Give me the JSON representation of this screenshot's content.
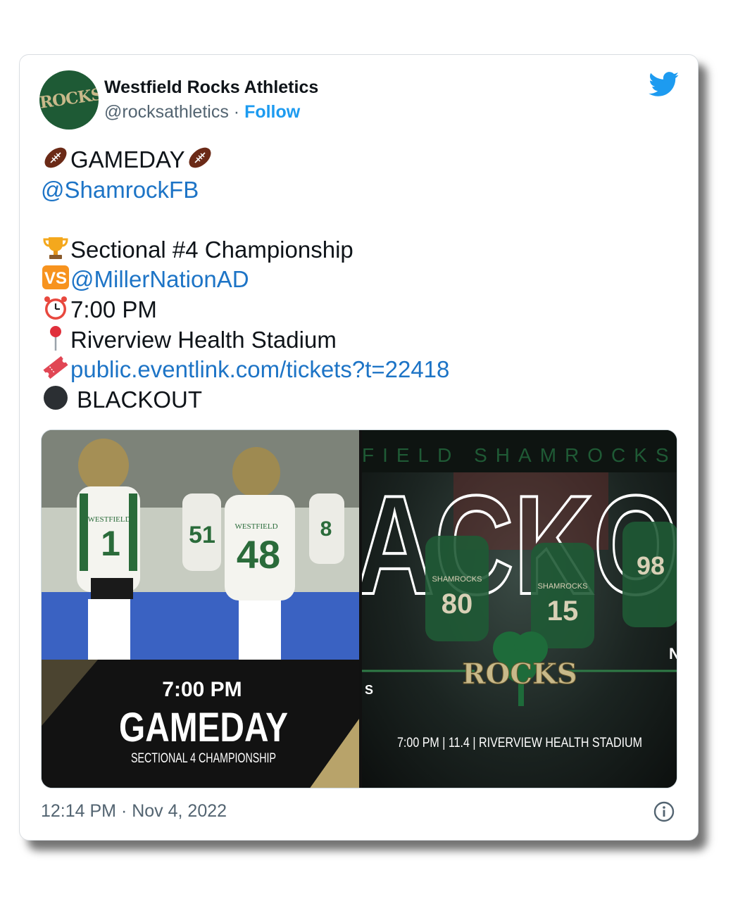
{
  "account": {
    "display_name": "Westfield Rocks Athletics",
    "handle": "@rocksathletics",
    "separator": "·",
    "follow_label": "Follow",
    "avatar_text": "ROCKS",
    "avatar_color": "#1e5a35"
  },
  "tweet": {
    "lines": {
      "gameday": "GAMEDAY",
      "mention_team": "@ShamrockFB",
      "championship": "Sectional #4 Championship",
      "opponent": "@MillerNationAD",
      "time": "7:00 PM",
      "venue": "Riverview Health Stadium",
      "tickets_link": "public.eventlink.com/tickets?t=22418",
      "theme": " BLACKOUT"
    },
    "emojis": [
      "football-emoji",
      "trophy-emoji",
      "vs-emoji",
      "alarm-clock-emoji",
      "round-pushpin-emoji",
      "ticket-emoji",
      "black-circle-emoji"
    ]
  },
  "media": {
    "left_image": {
      "time": "7:00 PM",
      "title": "GAMEDAY",
      "subtitle": "SECTIONAL 4 CHAMPIONSHIP",
      "jersey_numbers": [
        "1",
        "48",
        "51",
        "8"
      ],
      "jersey_text": "WESTFIELD"
    },
    "right_image": {
      "banner_top": "FIELD SHAMROCKS FOOT",
      "big_word": "ACKO",
      "logo_text": "ROCKS",
      "footer": "7:00 PM | 11.4 | RIVERVIEW HEALTH STADIUM",
      "edge_letter_right": "N",
      "edge_letter_left": "S",
      "jersey_numbers": [
        "80",
        "15",
        "98"
      ],
      "jersey_text": "SHAMROCKS"
    }
  },
  "footer": {
    "timestamp": "12:14 PM · Nov 4, 2022"
  },
  "colors": {
    "link": "#1d74c6",
    "follow": "#1d9bf0",
    "text": "#0f1419",
    "muted": "#536471",
    "twitter_blue": "#1d9bf0",
    "gold": "#c8b98a",
    "green": "#1e5a35"
  },
  "icons": {
    "brand": "twitter-bird-icon",
    "info": "info-icon"
  }
}
